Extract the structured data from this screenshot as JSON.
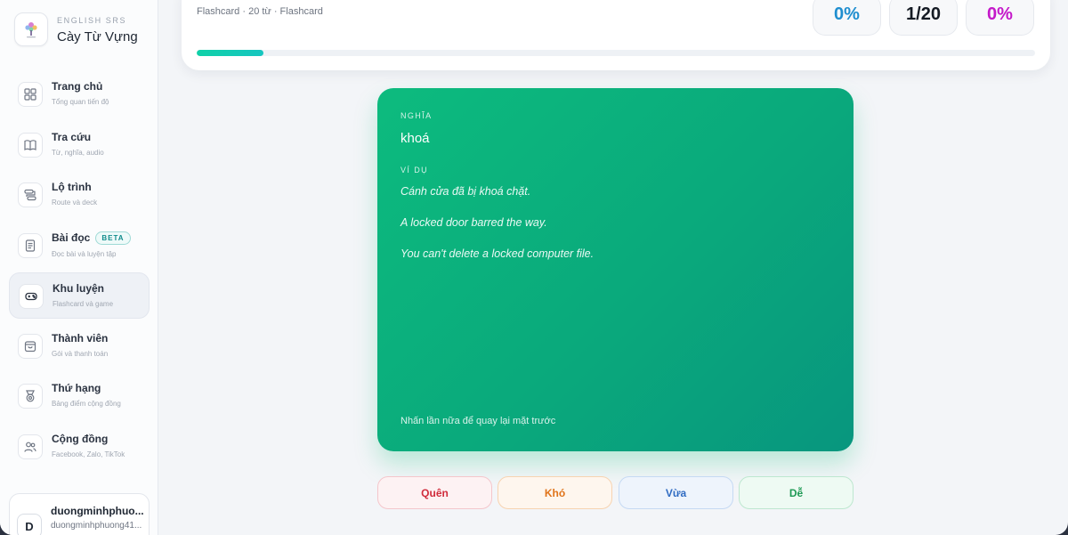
{
  "brand": {
    "kicker": "ENGLISH SRS",
    "name": "Cày Từ Vựng",
    "logo_icon": "tree-logo-icon"
  },
  "nav": [
    {
      "label": "Trang chủ",
      "sub": "Tổng quan tiến độ",
      "icon": "grid-icon",
      "active": false
    },
    {
      "label": "Tra cứu",
      "sub": "Từ, nghĩa, audio",
      "icon": "book-icon",
      "active": false
    },
    {
      "label": "Lộ trình",
      "sub": "Route và deck",
      "icon": "route-icon",
      "active": false
    },
    {
      "label": "Bài đọc",
      "sub": "Đọc bài và luyện tập",
      "icon": "document-icon",
      "badge": "BETA",
      "active": false
    },
    {
      "label": "Khu luyện",
      "sub": "Flashcard và game",
      "icon": "gamepad-icon",
      "active": true
    },
    {
      "label": "Thành viên",
      "sub": "Gói và thanh toán",
      "icon": "bag-icon",
      "active": false
    },
    {
      "label": "Thứ hạng",
      "sub": "Bảng điểm cộng đồng",
      "icon": "medal-icon",
      "active": false
    },
    {
      "label": "Cộng đồng",
      "sub": "Facebook, Zalo, TikTok",
      "icon": "users-icon",
      "active": false
    }
  ],
  "user": {
    "initial": "D",
    "name": "duongminhphuo...",
    "email": "duongminhphuong41..."
  },
  "session": {
    "meta": "Flashcard · 20 từ · Flashcard",
    "accuracy": "0%",
    "progress": "1/20",
    "score": "0%",
    "progress_fraction": 0.08
  },
  "card": {
    "meaning_label": "NGHĨA",
    "meaning": "khoá",
    "example_label": "VÍ DỤ",
    "examples": [
      "Cánh cửa đã bị khoá chặt.",
      "A locked door barred the way.",
      "You can't delete a locked computer file."
    ],
    "hint": "Nhấn lần nữa để quay lại mặt trước"
  },
  "ratings": {
    "forgot": "Quên",
    "hard": "Khó",
    "ok": "Vừa",
    "easy": "Dễ"
  },
  "colors": {
    "card_gradient_start": "#0dbb7e",
    "card_gradient_end": "#08967e",
    "progress_fill": "#10d1a8",
    "accuracy": "#1f8ecf",
    "score": "#c419c9"
  }
}
